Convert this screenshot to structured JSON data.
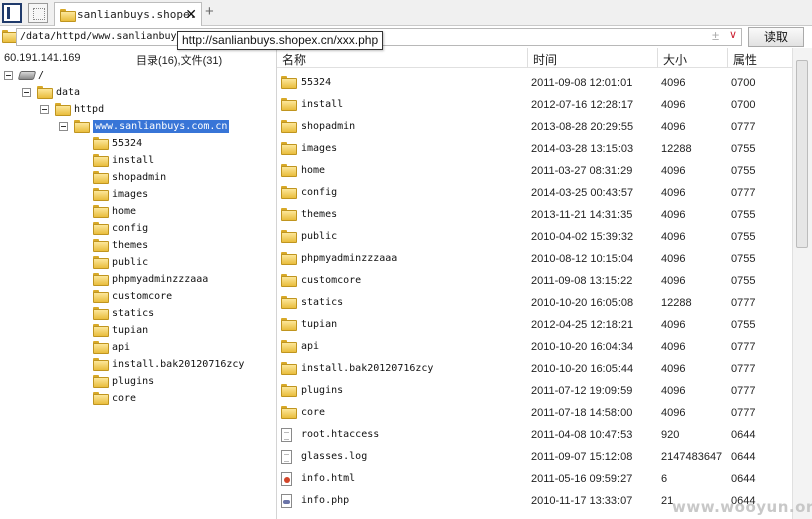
{
  "tabs": {
    "active_title": "sanlianbuys.shope.",
    "close_glyph": "✕",
    "add_glyph": "+"
  },
  "address": {
    "value": "/data/httpd/www.sanlianbuys",
    "plus_glyph": "±",
    "drop_glyph": "∨",
    "read_label": "读取"
  },
  "tooltip": {
    "text": "http://sanlianbuys.shopex.cn/xxx.php"
  },
  "info": {
    "ip": "60.191.141.169",
    "counts": "目录(16),文件(31)"
  },
  "tree": [
    {
      "label": "/",
      "icon": "drive-icon",
      "expanded": true,
      "depth": 0
    },
    {
      "label": "data",
      "icon": "folder-icon",
      "expanded": true,
      "depth": 1
    },
    {
      "label": "httpd",
      "icon": "folder-icon",
      "expanded": true,
      "depth": 2
    },
    {
      "label": "www.sanlianbuys.com.cn",
      "icon": "folder-icon",
      "expanded": true,
      "depth": 3,
      "selected": true
    },
    {
      "label": "55324",
      "icon": "folder-icon",
      "depth": 4
    },
    {
      "label": "install",
      "icon": "folder-icon",
      "depth": 4
    },
    {
      "label": "shopadmin",
      "icon": "folder-icon",
      "depth": 4
    },
    {
      "label": "images",
      "icon": "folder-icon",
      "depth": 4
    },
    {
      "label": "home",
      "icon": "folder-icon",
      "depth": 4
    },
    {
      "label": "config",
      "icon": "folder-icon",
      "depth": 4
    },
    {
      "label": "themes",
      "icon": "folder-icon",
      "depth": 4
    },
    {
      "label": "public",
      "icon": "folder-icon",
      "depth": 4
    },
    {
      "label": "phpmyadminzzzaaa",
      "icon": "folder-icon",
      "depth": 4
    },
    {
      "label": "customcore",
      "icon": "folder-icon",
      "depth": 4
    },
    {
      "label": "statics",
      "icon": "folder-icon",
      "depth": 4
    },
    {
      "label": "tupian",
      "icon": "folder-icon",
      "depth": 4
    },
    {
      "label": "api",
      "icon": "folder-icon",
      "depth": 4
    },
    {
      "label": "install.bak20120716zcy",
      "icon": "folder-icon",
      "depth": 4
    },
    {
      "label": "plugins",
      "icon": "folder-icon",
      "depth": 4
    },
    {
      "label": "core",
      "icon": "folder-icon",
      "depth": 4
    }
  ],
  "columns": {
    "name": "名称",
    "time": "时间",
    "size": "大小",
    "attr": "属性"
  },
  "files": [
    {
      "name": "55324",
      "icon": "folder-icon",
      "time": "2011-09-08 12:01:01",
      "size": "4096",
      "attr": "0700"
    },
    {
      "name": "install",
      "icon": "folder-icon",
      "time": "2012-07-16 12:28:17",
      "size": "4096",
      "attr": "0700"
    },
    {
      "name": "shopadmin",
      "icon": "folder-icon",
      "time": "2013-08-28 20:29:55",
      "size": "4096",
      "attr": "0777"
    },
    {
      "name": "images",
      "icon": "folder-icon",
      "time": "2014-03-28 13:15:03",
      "size": "12288",
      "attr": "0755"
    },
    {
      "name": "home",
      "icon": "folder-icon",
      "time": "2011-03-27 08:31:29",
      "size": "4096",
      "attr": "0755"
    },
    {
      "name": "config",
      "icon": "folder-icon",
      "time": "2014-03-25 00:43:57",
      "size": "4096",
      "attr": "0777"
    },
    {
      "name": "themes",
      "icon": "folder-icon",
      "time": "2013-11-21 14:31:35",
      "size": "4096",
      "attr": "0755"
    },
    {
      "name": "public",
      "icon": "folder-icon",
      "time": "2010-04-02 15:39:32",
      "size": "4096",
      "attr": "0755"
    },
    {
      "name": "phpmyadminzzzaaa",
      "icon": "folder-icon",
      "time": "2010-08-12 10:15:04",
      "size": "4096",
      "attr": "0755"
    },
    {
      "name": "customcore",
      "icon": "folder-icon",
      "time": "2011-09-08 13:15:22",
      "size": "4096",
      "attr": "0755"
    },
    {
      "name": "statics",
      "icon": "folder-icon",
      "time": "2010-10-20 16:05:08",
      "size": "12288",
      "attr": "0777"
    },
    {
      "name": "tupian",
      "icon": "folder-icon",
      "time": "2012-04-25 12:18:21",
      "size": "4096",
      "attr": "0755"
    },
    {
      "name": "api",
      "icon": "folder-icon",
      "time": "2010-10-20 16:04:34",
      "size": "4096",
      "attr": "0777"
    },
    {
      "name": "install.bak20120716zcy",
      "icon": "folder-icon",
      "time": "2010-10-20 16:05:44",
      "size": "4096",
      "attr": "0777"
    },
    {
      "name": "plugins",
      "icon": "folder-icon",
      "time": "2011-07-12 19:09:59",
      "size": "4096",
      "attr": "0777"
    },
    {
      "name": "core",
      "icon": "folder-icon",
      "time": "2011-07-18 14:58:00",
      "size": "4096",
      "attr": "0777"
    },
    {
      "name": "root.htaccess",
      "icon": "file-icon",
      "time": "2011-04-08 10:47:53",
      "size": "920",
      "attr": "0644"
    },
    {
      "name": "glasses.log",
      "icon": "file-icon",
      "time": "2011-09-07 15:12:08",
      "size": "2147483647",
      "attr": "0644"
    },
    {
      "name": "info.html",
      "icon": "html-icon",
      "time": "2011-05-16 09:59:27",
      "size": "6",
      "attr": "0644"
    },
    {
      "name": "info.php",
      "icon": "php-icon",
      "time": "2010-11-17 13:33:07",
      "size": "21",
      "attr": "0644"
    }
  ],
  "watermark": "www.wooyun.org"
}
